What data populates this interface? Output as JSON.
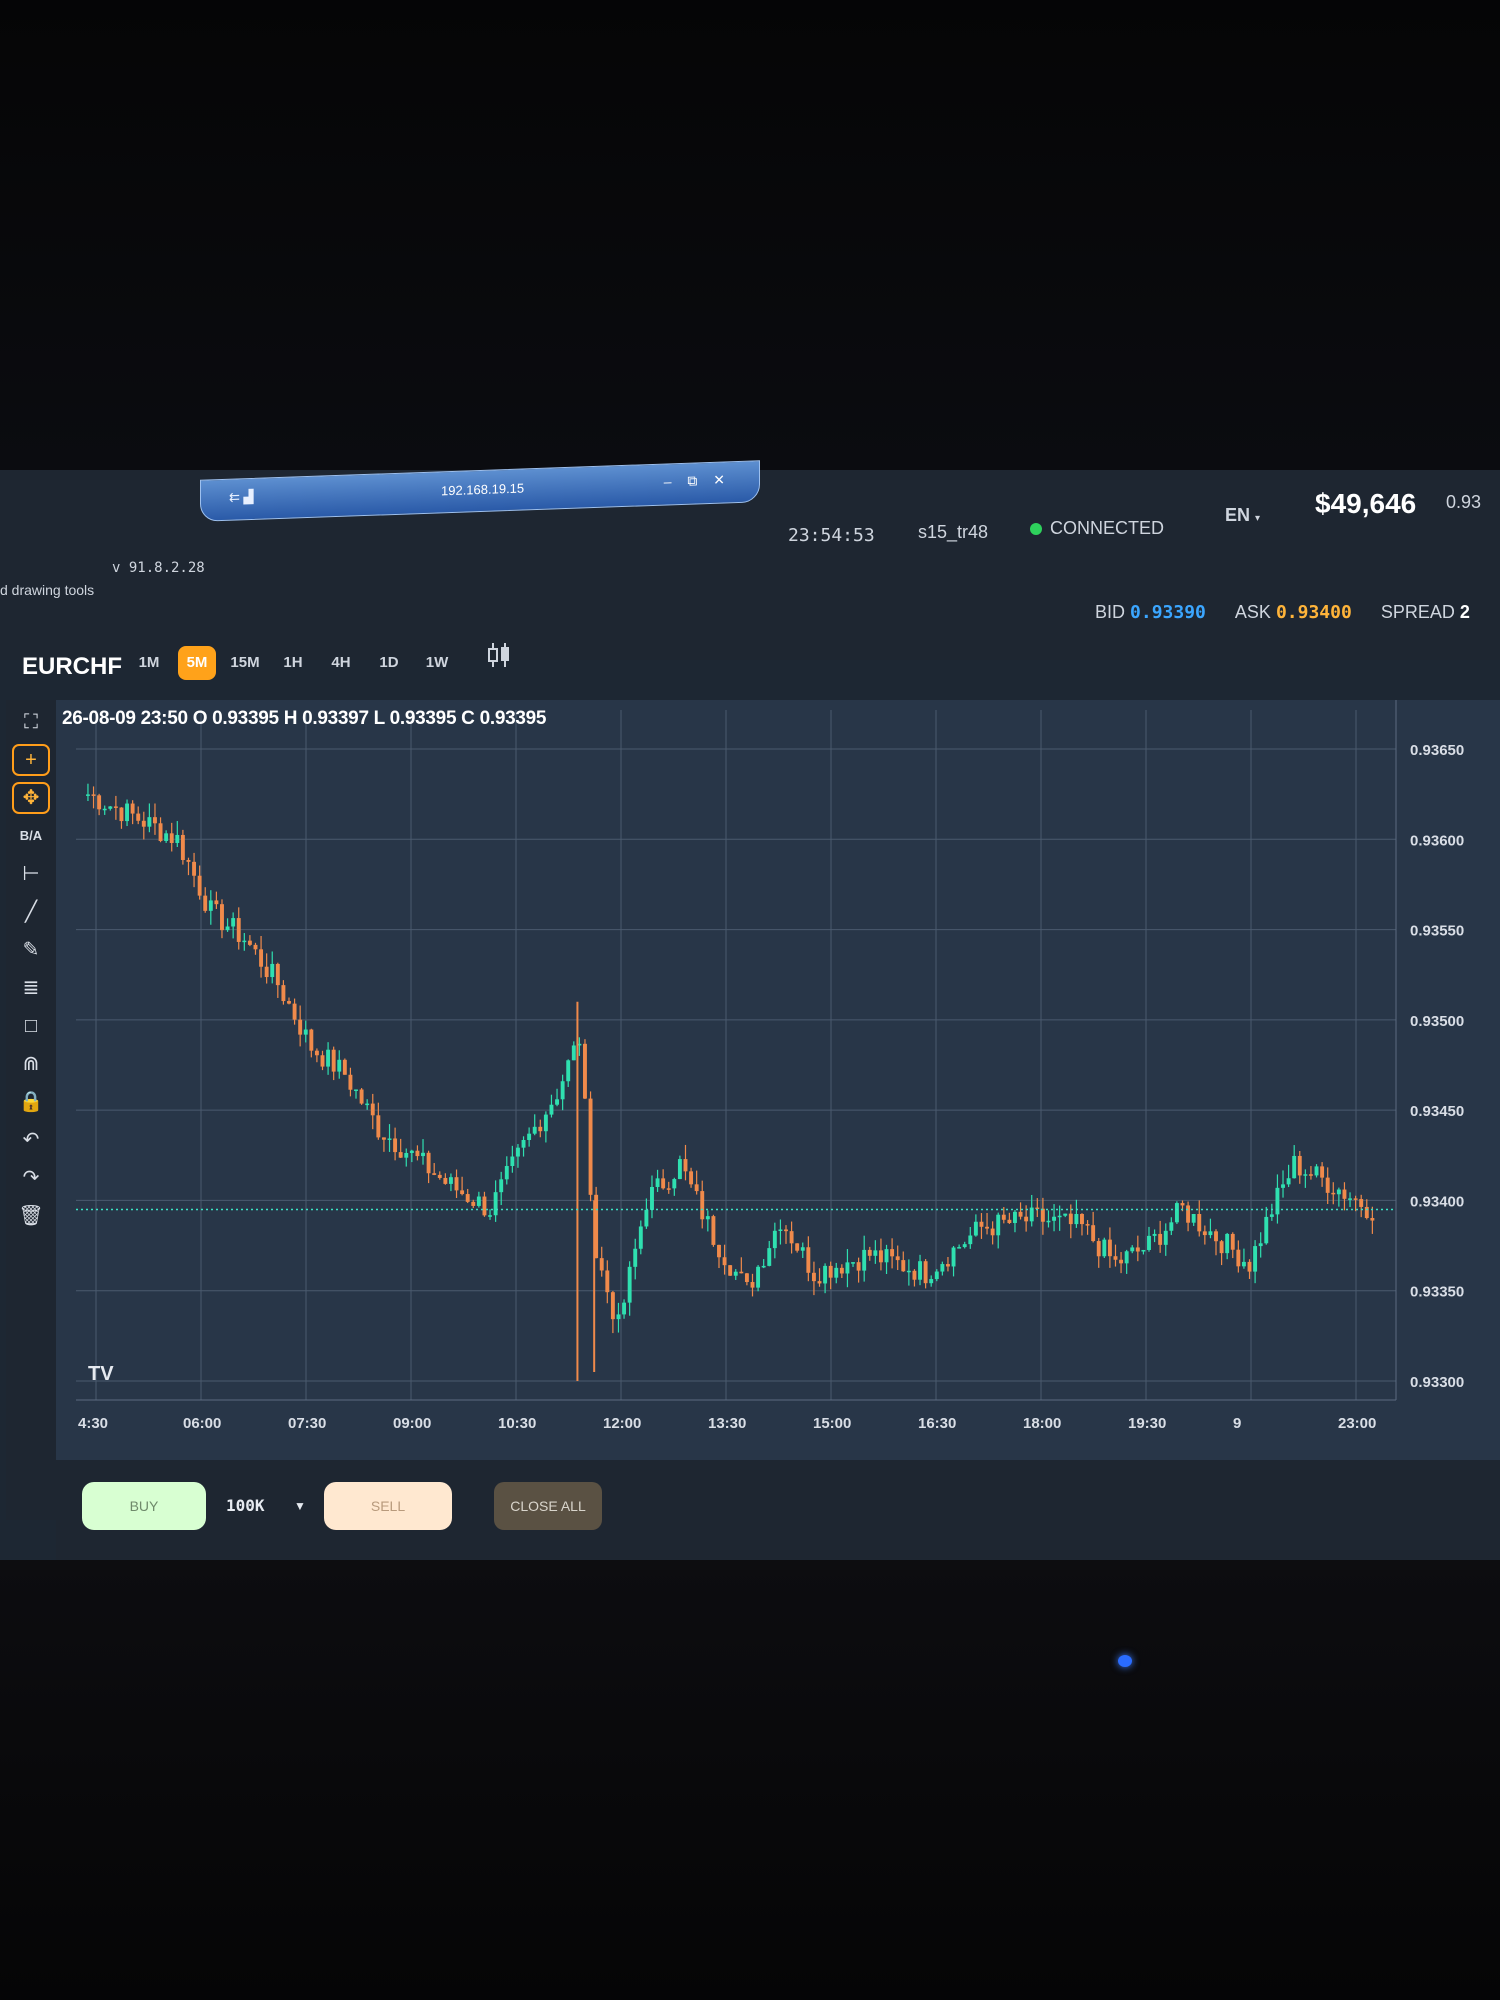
{
  "rdp": {
    "signal": "⇇ ▟",
    "host": "192.168.19.15",
    "controls": "‒ ⧉ ✕"
  },
  "header": {
    "clock": "23:54:53",
    "user": "s15_tr48",
    "status": "CONNECTED",
    "language": "EN",
    "balance": "$49,646",
    "balance_extra": "0.93",
    "version": "v 91.8.2.28",
    "tools_hint": "d drawing tools"
  },
  "quote": {
    "bid_label": "BID",
    "bid": "0.93390",
    "ask_label": "ASK",
    "ask": "0.93400",
    "spread_label": "SPREAD",
    "spread": "2"
  },
  "symbol": "EURCHF",
  "timeframes": [
    "1M",
    "5M",
    "15M",
    "1H",
    "4H",
    "1D",
    "1W"
  ],
  "timeframe_active": "5M",
  "toolbar": {
    "fullscreen": "⛶",
    "crosshair": "+",
    "move": "✥",
    "ba": "B/A",
    "measure": "⊢",
    "line": "╱",
    "pencil": "✎",
    "fib": "≣",
    "rect": "□",
    "magnet": "⋒",
    "lock": "🔒",
    "undo": "↶",
    "redo": "↷",
    "trash": "🗑"
  },
  "ohlc": "26-08-09 23:50 O 0.93395 H 0.93397 L 0.93395 C 0.93395",
  "watermark": "TV",
  "order": {
    "buy": "BUY",
    "lot": "100K",
    "sell": "SELL",
    "close_all": "CLOSE ALL"
  },
  "colors": {
    "up": "#2fe0b0",
    "down": "#f08a4b",
    "accent": "#ffa21a",
    "bid": "#3ba6ff",
    "ask": "#ffb43a"
  },
  "chart_data": {
    "type": "candlestick",
    "x_ticks": [
      "4:30",
      "06:00",
      "07:30",
      "09:00",
      "10:30",
      "12:00",
      "13:30",
      "15:00",
      "16:30",
      "18:00",
      "19:30",
      "9",
      "23:00"
    ],
    "y_ticks": [
      "0.93650",
      "0.93600",
      "0.93550",
      "0.93500",
      "0.93450",
      "0.93400",
      "0.93350",
      "0.93300"
    ],
    "ylim": [
      0.93295,
      0.93655
    ],
    "current_price": 0.93395,
    "anchors": [
      [
        0,
        0.93625
      ],
      [
        10,
        0.9361
      ],
      [
        16,
        0.936
      ],
      [
        22,
        0.9356
      ],
      [
        28,
        0.93545
      ],
      [
        34,
        0.9352
      ],
      [
        40,
        0.93485
      ],
      [
        46,
        0.9347
      ],
      [
        52,
        0.9344
      ],
      [
        58,
        0.93425
      ],
      [
        64,
        0.9341
      ],
      [
        72,
        0.93395
      ],
      [
        78,
        0.9343
      ],
      [
        84,
        0.9346
      ],
      [
        88,
        0.9349
      ],
      [
        91,
        0.9337
      ],
      [
        95,
        0.9333
      ],
      [
        100,
        0.934
      ],
      [
        106,
        0.9342
      ],
      [
        112,
        0.9338
      ],
      [
        118,
        0.9335
      ],
      [
        124,
        0.9339
      ],
      [
        130,
        0.9336
      ],
      [
        140,
        0.9337
      ],
      [
        150,
        0.9336
      ],
      [
        160,
        0.93385
      ],
      [
        170,
        0.9339
      ],
      [
        178,
        0.93385
      ],
      [
        184,
        0.93365
      ],
      [
        190,
        0.93375
      ],
      [
        196,
        0.93395
      ],
      [
        202,
        0.9338
      ],
      [
        208,
        0.93365
      ],
      [
        212,
        0.93395
      ],
      [
        216,
        0.9342
      ],
      [
        222,
        0.9341
      ],
      [
        230,
        0.93395
      ]
    ]
  }
}
